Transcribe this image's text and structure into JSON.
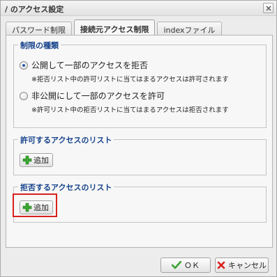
{
  "dialog": {
    "title": "/ のアクセス設定",
    "close_icon": "close-icon"
  },
  "tabs": [
    {
      "label": "パスワード制限",
      "active": false
    },
    {
      "label": "接続元アクセス制限",
      "active": true
    },
    {
      "label": "indexファイル",
      "active": false
    }
  ],
  "restriction_type": {
    "legend": "制限の種類",
    "options": [
      {
        "label": "公開して一部のアクセスを拒否",
        "note": "※拒否リスト中の許可リストに当てはまるアクセスは許可されます",
        "checked": true
      },
      {
        "label": "非公開にして一部のアクセスを許可",
        "note": "※許可リスト中の拒否リストに当てはまるアクセスは拒否されます",
        "checked": false
      }
    ]
  },
  "allow_list": {
    "legend": "許可するアクセスのリスト",
    "add_label": "追加",
    "add_icon": "plus-icon"
  },
  "deny_list": {
    "legend": "拒否するアクセスのリスト",
    "add_label": "追加",
    "add_icon": "plus-icon"
  },
  "footer": {
    "ok_label": "ＯＫ",
    "ok_icon": "check-icon",
    "cancel_label": "キャンセル",
    "cancel_icon": "cross-icon"
  },
  "colors": {
    "legend_text": "#15428b",
    "highlight_border": "#d9211d",
    "plus_icon": "#3aa531",
    "check_icon": "#3aa531",
    "cross_icon": "#d9211d"
  }
}
